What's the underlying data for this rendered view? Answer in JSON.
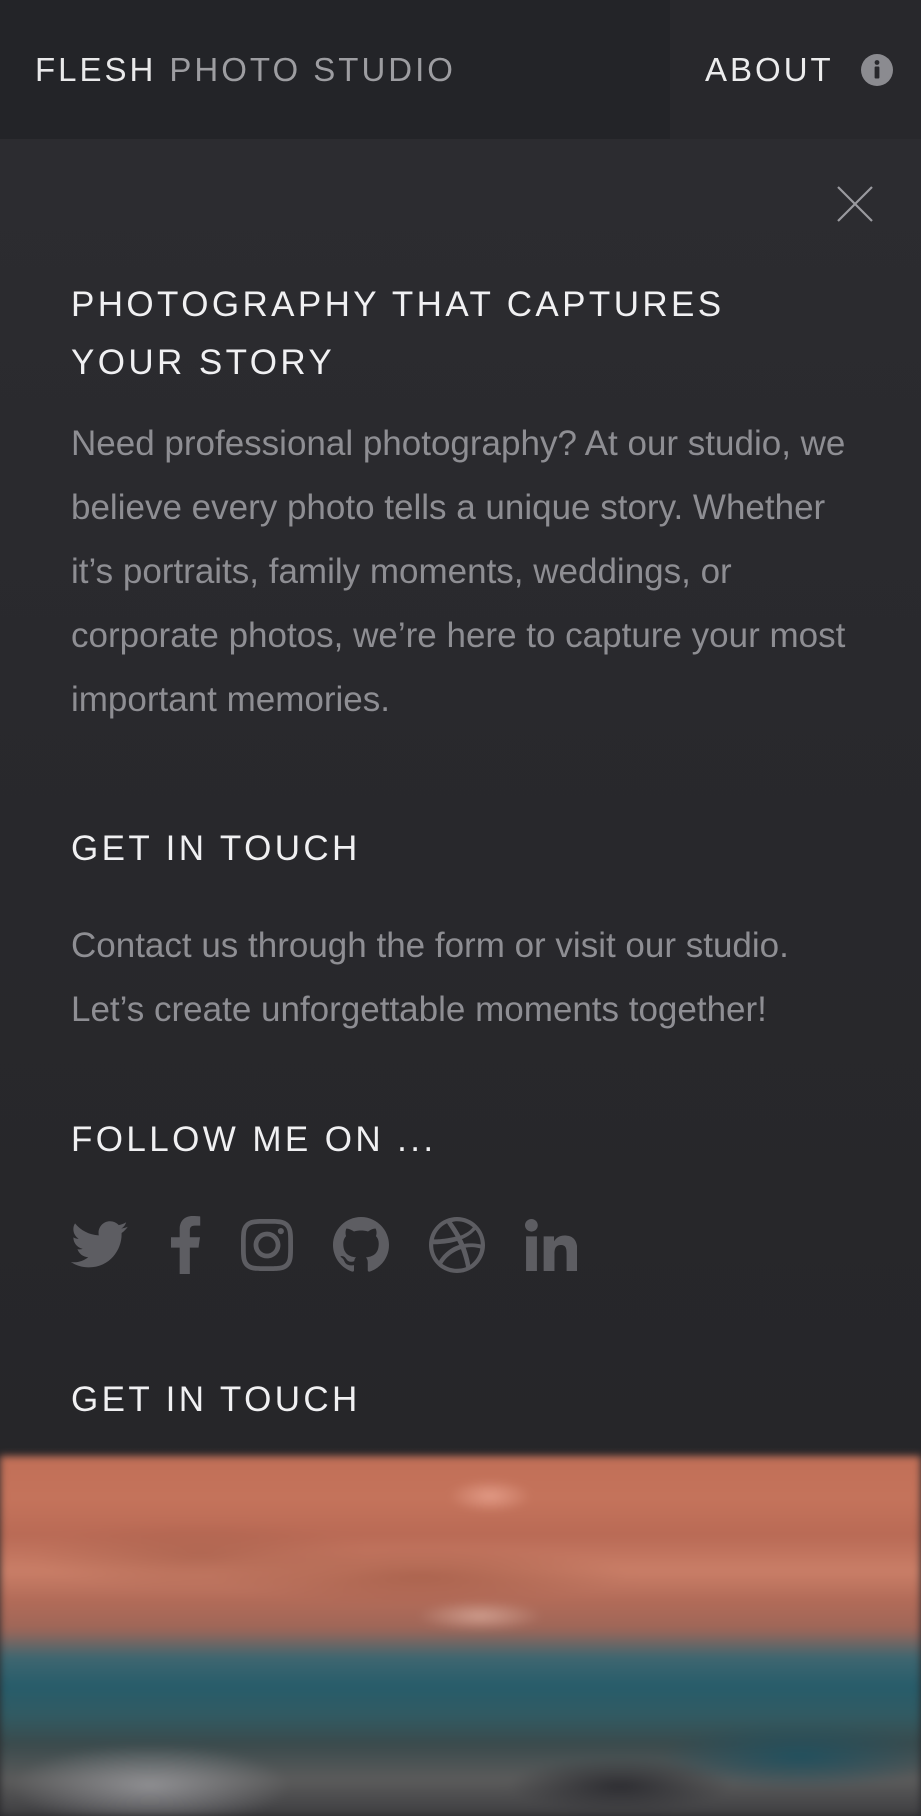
{
  "header": {
    "brand_strong": "FLESH",
    "brand_light": "PHOTO STUDIO",
    "about_label": "ABOUT",
    "about_icon": "info-circle-icon"
  },
  "panel": {
    "close_icon": "close-icon",
    "section1": {
      "heading": "PHOTOGRAPHY THAT CAPTURES YOUR STORY",
      "body": "Need professional photography? At our studio, we believe every photo tells a unique story. Whether it’s portraits, family moments, weddings, or corporate photos, we’re here to capture your most important memories."
    },
    "section2": {
      "heading": "GET IN TOUCH",
      "body": "Contact us through the form or visit our studio. Let’s create unforgettable moments together!"
    },
    "section3": {
      "heading": "FOLLOW ME ON ..."
    },
    "social": [
      {
        "name": "twitter-icon"
      },
      {
        "name": "facebook-icon"
      },
      {
        "name": "instagram-icon"
      },
      {
        "name": "github-icon"
      },
      {
        "name": "dribbble-icon"
      },
      {
        "name": "linkedin-icon"
      }
    ],
    "section4": {
      "heading": "GET IN TOUCH"
    }
  },
  "colors": {
    "background": "#28282c",
    "header_brand_bg": "#232428",
    "heading_text": "#f0f0f2",
    "body_text": "#8e8e93",
    "icon": "#5d5d62"
  }
}
